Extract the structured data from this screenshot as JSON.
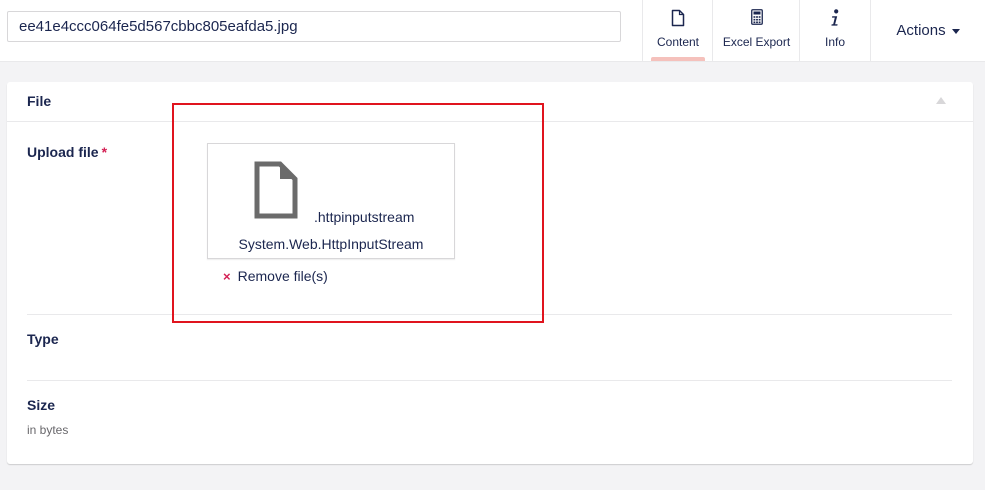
{
  "header": {
    "name_value": "ee41e4ccc064fe5d567cbbc805eafda5.jpg",
    "tabs": [
      {
        "label": "Content",
        "icon": "document-icon"
      },
      {
        "label": "Excel Export",
        "icon": "calculator-icon"
      },
      {
        "label": "Info",
        "icon": "info-icon"
      }
    ],
    "actions_label": "Actions"
  },
  "panel": {
    "title": "File",
    "upload": {
      "label": "Upload file",
      "required_mark": "*",
      "file_extension": ".httpinputstream",
      "file_name": "System.Web.HttpInputStream",
      "remove_label": "Remove file(s)",
      "remove_icon": "×"
    },
    "type": {
      "label": "Type"
    },
    "size": {
      "label": "Size",
      "description": "in bytes"
    }
  },
  "colors": {
    "text": "#1b264f",
    "accent_underline": "#f5c1bc",
    "required": "#d42054",
    "highlight_box": "#e0141e"
  }
}
